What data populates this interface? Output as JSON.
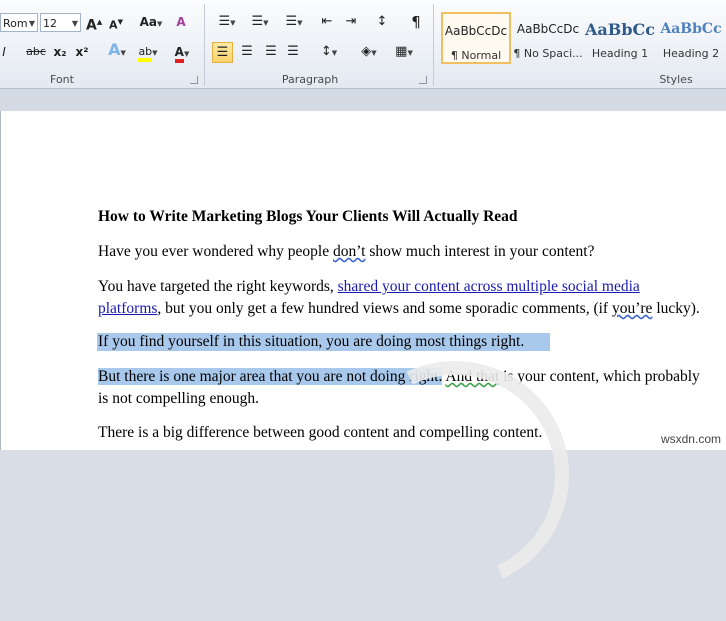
{
  "font": {
    "name": "Rom",
    "size": "12",
    "label": "Font",
    "grow_label": "A",
    "shrink_label": "A",
    "case_label": "Aa",
    "clear_label": "A",
    "strike_label": "abc",
    "sub_label": "x₂",
    "sup_label": "x²",
    "effects_label": "A",
    "highlight_label": "ab",
    "color_label": "A"
  },
  "paragraph": {
    "label": "Paragraph",
    "pilcrow": "¶"
  },
  "styles": {
    "label": "Styles",
    "items": [
      {
        "sample": "AaBbCcDc",
        "name": "¶ Normal"
      },
      {
        "sample": "AaBbCcDc",
        "name": "¶ No Spaci..."
      },
      {
        "sample": "AaBbCc",
        "name": "Heading 1"
      },
      {
        "sample": "AaBbCc",
        "name": "Heading 2"
      }
    ]
  },
  "document": {
    "title": "How to Write Marketing Blogs Your Clients Will Actually Read",
    "p1": {
      "a": "Have you ever wondered why people ",
      "b": "don’t",
      "c": " show much interest in your content?"
    },
    "p2a": {
      "a": "You have targeted the right keywords, ",
      "link1": "shared your content across multiple social media"
    },
    "p2b": {
      "link2": "platforms",
      "a": ", but you only get a few hundred views and some sporadic comments, (if ",
      "b": "you’re",
      "c": " lucky)."
    },
    "p3": "If you find yourself in this situation, you are doing most things right.",
    "p4a": {
      "a": "But there is one major area that you are not doing right.",
      "b": " ",
      "c": "And that",
      "d": " is your content, which probably"
    },
    "p4b": {
      "a": "is not compelling ",
      "b": " enough."
    },
    "p5": "There is a big  difference between good content and compelling  content."
  },
  "watermark": "wsxdn.com",
  "colors": {
    "selection": "#a9c9ec",
    "link": "#1a1ab0",
    "ribbon_selected": "#fbd36a"
  }
}
